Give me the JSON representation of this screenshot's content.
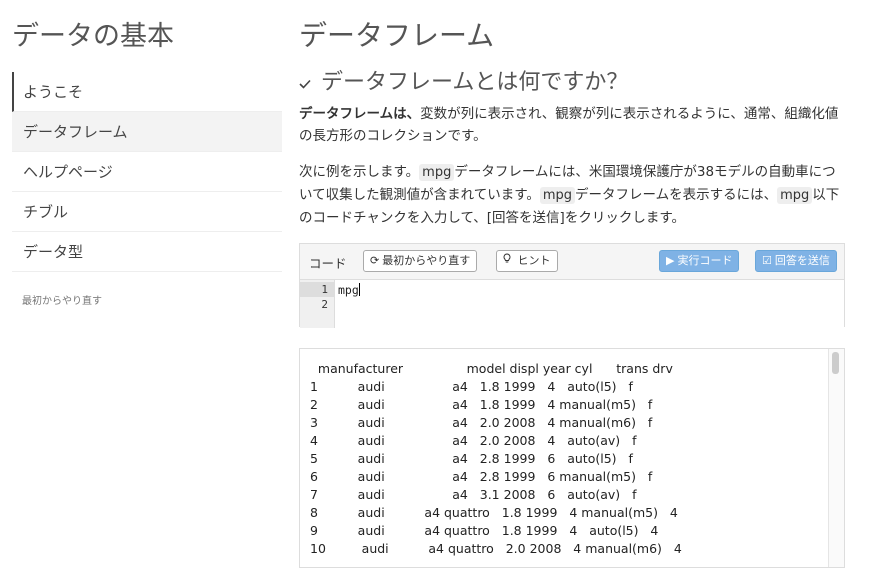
{
  "sidebar": {
    "title": "データの基本",
    "items": [
      {
        "label": "ようこそ"
      },
      {
        "label": "データフレーム"
      },
      {
        "label": "ヘルプページ"
      },
      {
        "label": "チブル"
      },
      {
        "label": "データ型"
      }
    ],
    "start_over": "最初からやり直す"
  },
  "main": {
    "title": "データフレーム",
    "section_title": "データフレームとは何ですか？",
    "para1_bold": "データフレームは、",
    "para1_rest": "変数が列に表示され、観察が列に表示されるように、通常、組織化値の長方形のコレクションです。",
    "para2_a": "次に例を示します。",
    "para2_code1": "mpg",
    "para2_b": "データフレームには、米国環境保護庁が38モデルの自動車について収集した観測値が含まれています。",
    "para2_code2": "mpg",
    "para2_c": "データフレームを表示するには、",
    "para2_code3": "mpg",
    "para2_d": "以下のコードチャンクを入力して、[回答を送信]をクリックします。"
  },
  "exercise": {
    "label": "コード",
    "start_over_button": "最初からやり直す",
    "hint_button": "ヒント",
    "run_button": "実行コード",
    "submit_button": "回答を送信",
    "line_numbers": [
      "1",
      "2"
    ],
    "code": "mpg"
  },
  "output": {
    "header": "   manufacturer                model displ year cyl      trans drv",
    "rows": [
      "1          audi                 a4   1.8 1999   4   auto(l5)   f",
      "2          audi                 a4   1.8 1999   4 manual(m5)   f",
      "3          audi                 a4   2.0 2008   4 manual(m6)   f",
      "4          audi                 a4   2.0 2008   4   auto(av)   f",
      "5          audi                 a4   2.8 1999   6   auto(l5)   f",
      "6          audi                 a4   2.8 1999   6 manual(m5)   f",
      "7          audi                 a4   3.1 2008   6   auto(av)   f",
      "8          audi          a4 quattro   1.8 1999   4 manual(m5)   4",
      "9          audi          a4 quattro   1.8 1999   4   auto(l5)   4",
      "10         audi          a4 quattro   2.0 2008   4 manual(m6)   4"
    ]
  },
  "colors": {
    "primary_button": "#7fb2e5",
    "nav_active_bg": "#f3f3f3"
  }
}
